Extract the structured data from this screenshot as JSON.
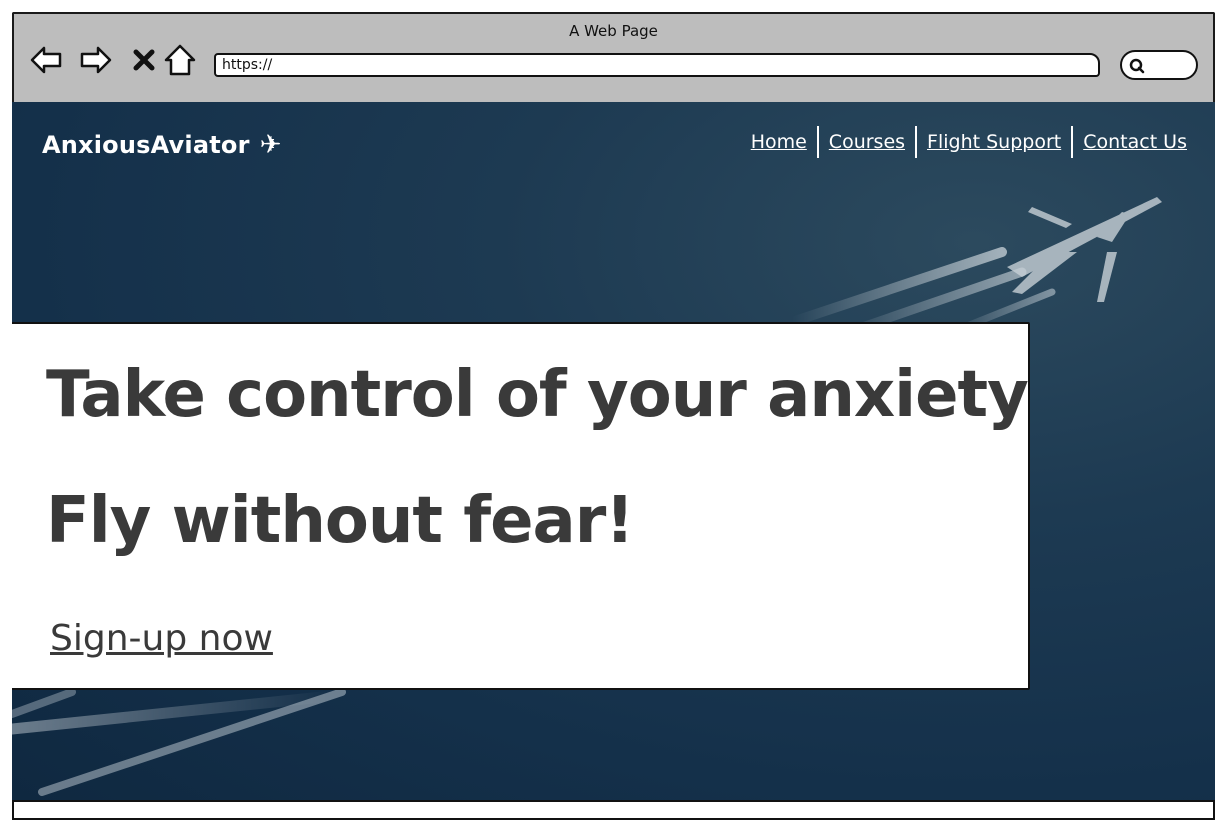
{
  "browser": {
    "window_title": "A Web Page",
    "address": "https://",
    "icons": [
      "back-arrow-icon",
      "forward-arrow-icon",
      "close-x-icon",
      "home-icon",
      "search-icon"
    ]
  },
  "site": {
    "brand": "AnxiousAviator",
    "brand_icon": "✈",
    "nav": [
      "Home",
      "Courses",
      "Flight Support",
      "Contact Us"
    ]
  },
  "hero": {
    "headline_1": "Take control of your anxiety",
    "headline_2": "Fly without fear!",
    "cta": "Sign-up now"
  },
  "colors": {
    "sky": "#1d3a52",
    "chrome": "#bdbdbd",
    "text_dark": "#3a3a3a",
    "white": "#ffffff"
  }
}
